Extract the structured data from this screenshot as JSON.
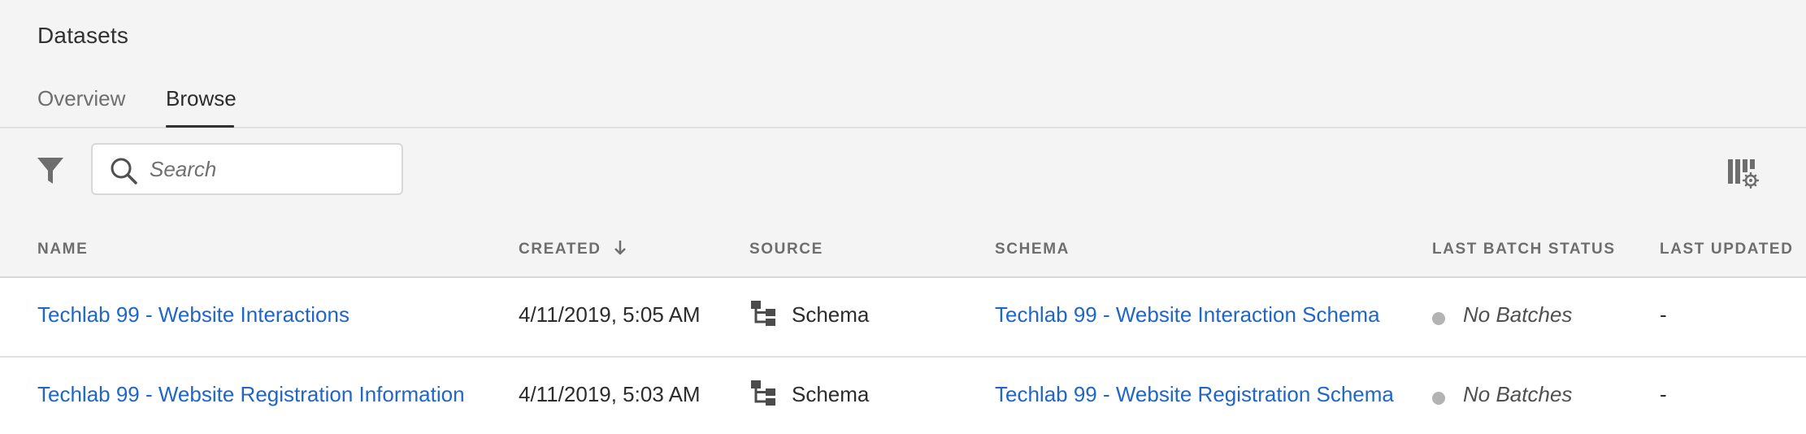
{
  "header": {
    "title": "Datasets"
  },
  "tabs": [
    {
      "label": "Overview",
      "active": false
    },
    {
      "label": "Browse",
      "active": true
    }
  ],
  "toolbar": {
    "filter_icon": "filter-icon",
    "search_placeholder": "Search",
    "search_value": "",
    "column_settings_icon": "column-settings-icon"
  },
  "table": {
    "columns": {
      "name": "NAME",
      "created": "CREATED",
      "source": "SOURCE",
      "schema": "SCHEMA",
      "last_batch_status": "LAST BATCH STATUS",
      "last_updated": "LAST UPDATED"
    },
    "sort": {
      "column": "created",
      "direction": "descending"
    },
    "rows": [
      {
        "name": "Techlab 99 - Website Interactions",
        "created": "4/11/2019, 5:05 AM",
        "source": "Schema",
        "schema": "Techlab 99 - Website Interaction Schema",
        "last_batch_status": "No Batches",
        "last_updated": "-"
      },
      {
        "name": "Techlab 99 - Website Registration Information",
        "created": "4/11/2019, 5:03 AM",
        "source": "Schema",
        "schema": "Techlab 99 - Website Registration Schema",
        "last_batch_status": "No Batches",
        "last_updated": "-"
      }
    ]
  },
  "colors": {
    "background": "#f4f4f4",
    "link": "#1f66c6",
    "status_dot": "#b3b3b3",
    "header_text": "#6e6e6e"
  }
}
